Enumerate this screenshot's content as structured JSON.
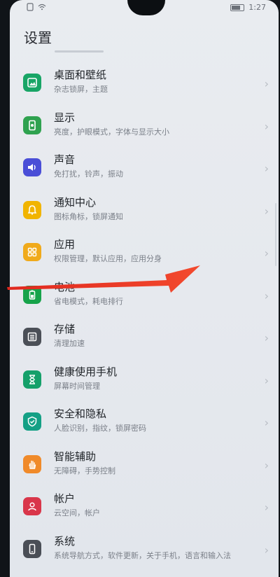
{
  "status": {
    "time": "1:27",
    "left_icons": [
      "sim-icon",
      "wifi-icon"
    ]
  },
  "page": {
    "title": "设置"
  },
  "items": [
    {
      "label": "桌面和壁纸",
      "sub": "杂志锁屏，主题",
      "icon": "wallpaper-icon",
      "color": "#18a566"
    },
    {
      "label": "显示",
      "sub": "亮度，护眼模式，字体与显示大小",
      "icon": "display-icon",
      "color": "#2fa24f"
    },
    {
      "label": "声音",
      "sub": "免打扰，铃声，振动",
      "icon": "sound-icon",
      "color": "#4a4ed7"
    },
    {
      "label": "通知中心",
      "sub": "图标角标，锁屏通知",
      "icon": "bell-icon",
      "color": "#f1b400"
    },
    {
      "label": "应用",
      "sub": "权限管理，默认应用，应用分身",
      "icon": "apps-icon",
      "color": "#f0aa1b"
    },
    {
      "label": "电池",
      "sub": "省电模式，耗电排行",
      "icon": "battery-icon",
      "color": "#16a34a"
    },
    {
      "label": "存储",
      "sub": "清理加速",
      "icon": "storage-icon",
      "color": "#4b4f57"
    },
    {
      "label": "健康使用手机",
      "sub": "屏幕时间管理",
      "icon": "hourglass-icon",
      "color": "#15a06a"
    },
    {
      "label": "安全和隐私",
      "sub": "人脸识别，指纹，锁屏密码",
      "icon": "shield-icon",
      "color": "#14a085"
    },
    {
      "label": "智能辅助",
      "sub": "无障碍，手势控制",
      "icon": "hand-icon",
      "color": "#f08a2a"
    },
    {
      "label": "帐户",
      "sub": "云空间，帐户",
      "icon": "user-icon",
      "color": "#d9364a"
    },
    {
      "label": "系统",
      "sub": "系统导航方式，软件更新，关于手机，语言和输入法",
      "icon": "phone-icon",
      "color": "#4a4e56"
    }
  ]
}
